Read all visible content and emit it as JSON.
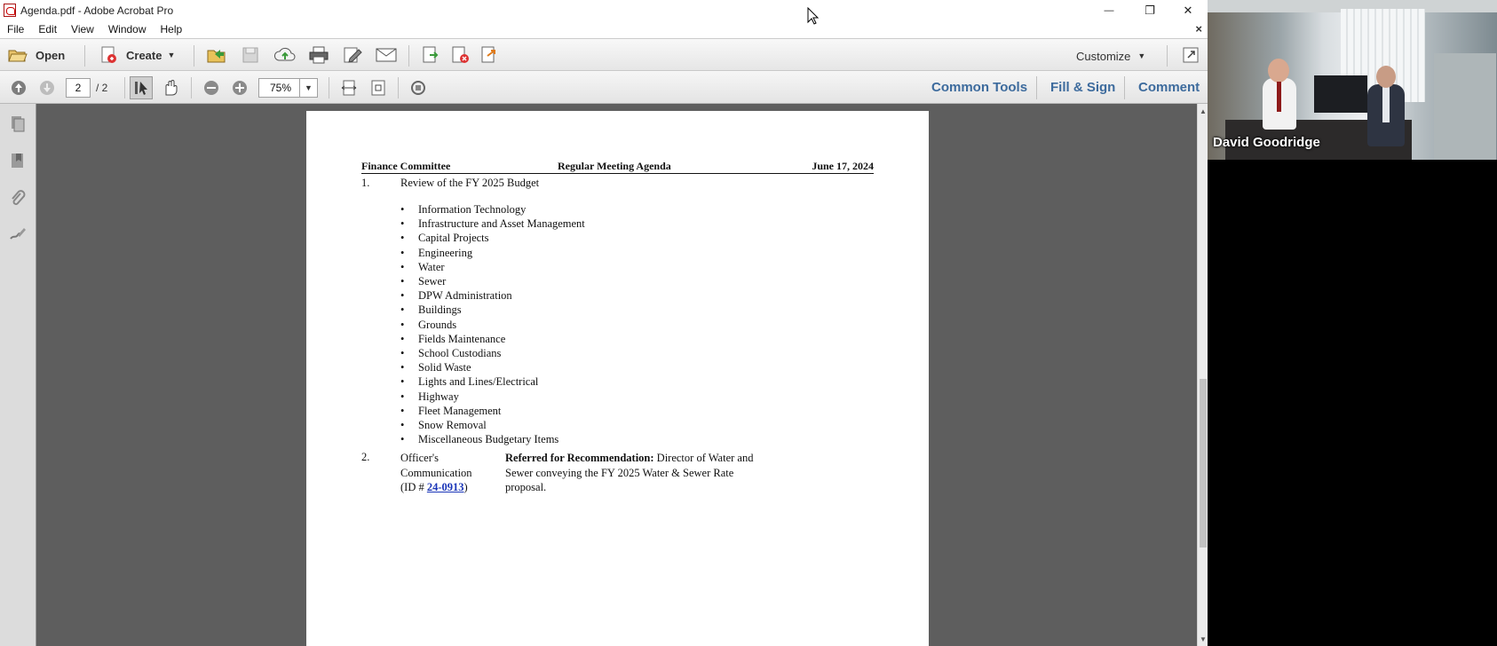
{
  "window": {
    "title": "Agenda.pdf - Adobe Acrobat Pro",
    "minimize_glyph": "—",
    "restore_glyph": "❐",
    "close_glyph": "✕"
  },
  "menu": {
    "items": [
      "File",
      "Edit",
      "View",
      "Window",
      "Help"
    ],
    "close_doc_glyph": "×"
  },
  "toolbar": {
    "open_label": "Open",
    "create_label": "Create",
    "customize_label": "Customize"
  },
  "nav": {
    "current_page": "2",
    "total_pages": "/ 2",
    "zoom": "75%"
  },
  "panes": {
    "common_tools": "Common Tools",
    "fill_sign": "Fill & Sign",
    "comment": "Comment"
  },
  "document": {
    "header_left": "Finance Committee",
    "header_center": "Regular Meeting Agenda",
    "header_right": "June 17, 2024",
    "item1_number": "1.",
    "item1_title": "Review of the FY 2025 Budget",
    "item1_bullets": [
      "Information Technology",
      "Infrastructure and Asset Management",
      "Capital Projects",
      "Engineering",
      "Water",
      "Sewer",
      "DPW Administration",
      "Buildings",
      "Grounds",
      "Fields Maintenance",
      "School Custodians",
      "Solid Waste",
      "Lights and Lines/Electrical",
      "Highway",
      "Fleet Management",
      "Snow Removal",
      "Miscellaneous Budgetary Items"
    ],
    "item2_number": "2.",
    "item2_line1": "Officer's",
    "item2_line2": "Communication",
    "item2_id_prefix": "(ID # ",
    "item2_id": "24-0913",
    "item2_id_suffix": ")",
    "item2_bold": "Referred for Recommendation:",
    "item2_text_line1": " Director of Water and",
    "item2_text_line2": "Sewer conveying the FY 2025 Water & Sewer Rate",
    "item2_text_line3": "proposal."
  },
  "video": {
    "participant_name": "David Goodridge"
  }
}
